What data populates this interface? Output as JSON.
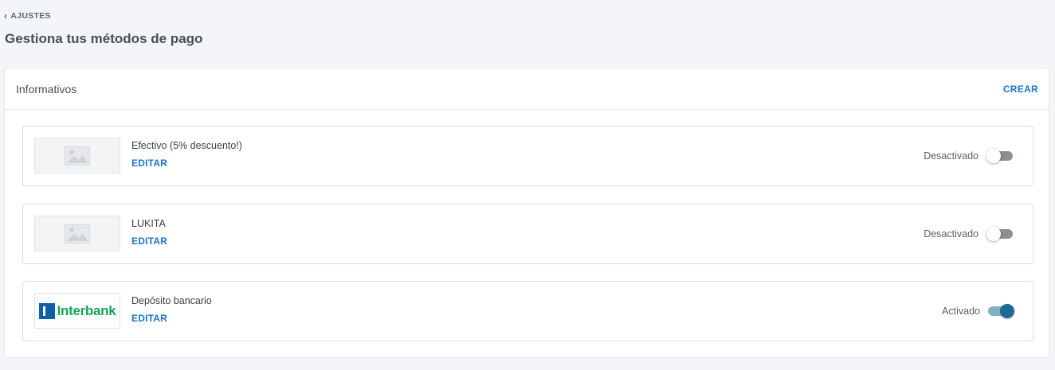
{
  "breadcrumb": {
    "label": "AJUSTES",
    "icon": "chevron-left-icon"
  },
  "page": {
    "title": "Gestiona tus métodos de pago"
  },
  "card": {
    "title": "Informativos",
    "create_label": "CREAR"
  },
  "colors": {
    "accent": "#1a73c8",
    "toggle_on": "#1e6a93",
    "toggle_off": "#8b8f93",
    "brand_green": "#18a35a",
    "brand_blue": "#0d5fa8"
  },
  "methods": [
    {
      "name": "Efectivo (5% descuento!)",
      "edit_label": "EDITAR",
      "status": "Desactivado",
      "enabled": false,
      "image": "image-placeholder-icon"
    },
    {
      "name": "LUKITA",
      "edit_label": "EDITAR",
      "status": "Desactivado",
      "enabled": false,
      "image": "image-placeholder-icon"
    },
    {
      "name": "Depósito bancario",
      "edit_label": "EDITAR",
      "status": "Activado",
      "enabled": true,
      "image": "interbank-logo",
      "logo_text": "Interbank"
    }
  ]
}
